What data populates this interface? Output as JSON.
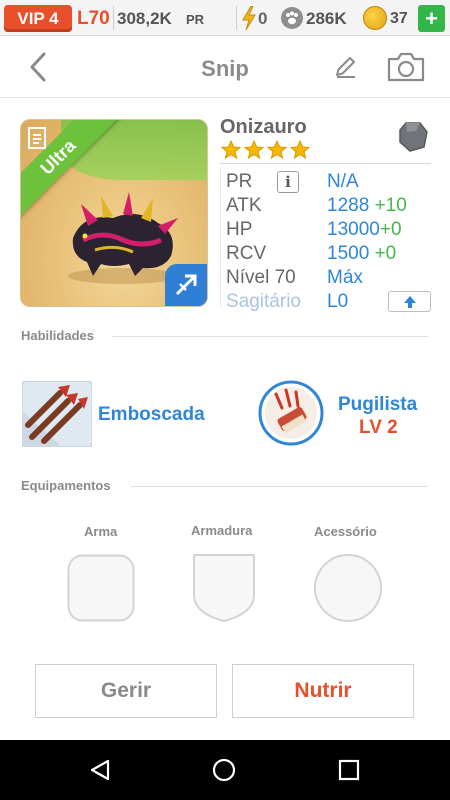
{
  "topbar": {
    "vip": "VIP 4",
    "level": "L70",
    "power": "308,2K",
    "power_label": "PR",
    "energy": "0",
    "food": "286K",
    "gold": "37",
    "add": "+"
  },
  "header": {
    "title": "Snip"
  },
  "creature": {
    "name": "Onizauro",
    "rarity": "Ultra",
    "stars": 4,
    "element_icon": "stone-gem-icon",
    "class_icon": "sagittarius-arrow-icon"
  },
  "stats": {
    "pr_label": "PR",
    "pr_value": "N/A",
    "atk_label": "ATK",
    "atk_value": "1288",
    "atk_bonus": "+10",
    "hp_label": "HP",
    "hp_value": "13000",
    "hp_bonus": "+0",
    "rcv_label": "RCV",
    "rcv_value": "1500",
    "rcv_bonus": "+0",
    "level_label": "Nível 70",
    "level_value": "Máx",
    "class_label": "Sagitário",
    "class_value": "L0"
  },
  "skills": {
    "header": "Habilidades",
    "skill1_name": "Emboscada",
    "skill2_name": "Pugilista",
    "skill2_level": "LV 2"
  },
  "equipment": {
    "header": "Equipamentos",
    "slot1": "Arma",
    "slot2": "Armadura",
    "slot3": "Acessório"
  },
  "actions": {
    "manage": "Gerir",
    "feed": "Nutrir"
  },
  "colors": {
    "accent_orange": "#e8502c",
    "accent_blue": "#2f86d8",
    "bonus_green": "#47b74d",
    "ultra_green": "#6cc23a"
  }
}
